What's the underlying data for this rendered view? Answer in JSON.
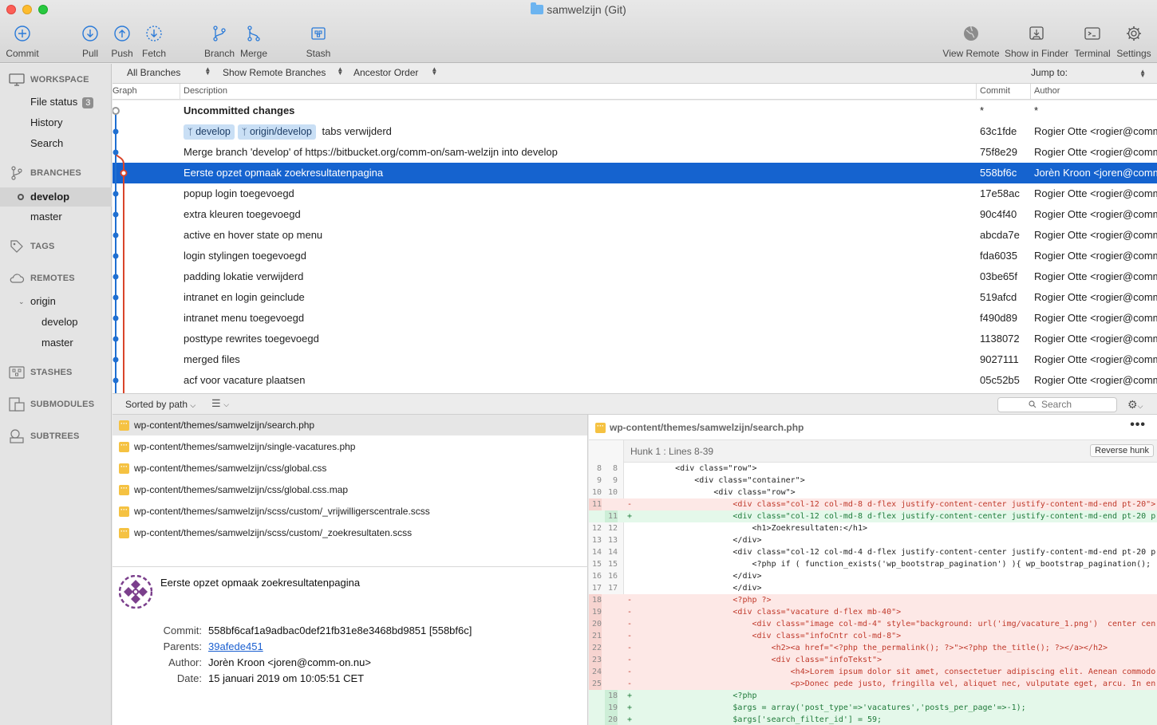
{
  "window": {
    "title": "samwelzijn (Git)"
  },
  "toolbar": {
    "commit": "Commit",
    "pull": "Pull",
    "push": "Push",
    "fetch": "Fetch",
    "branch": "Branch",
    "merge": "Merge",
    "stash": "Stash",
    "view_remote": "View Remote",
    "show_in_finder": "Show in Finder",
    "terminal": "Terminal",
    "settings": "Settings"
  },
  "sidebar": {
    "workspace": "WORKSPACE",
    "file_status": "File status",
    "file_status_count": "3",
    "history": "History",
    "search": "Search",
    "branches": "BRANCHES",
    "branch_items": [
      "develop",
      "master"
    ],
    "tags": "TAGS",
    "remotes": "REMOTES",
    "remote_name": "origin",
    "remote_items": [
      "develop",
      "master"
    ],
    "stashes": "STASHES",
    "submodules": "SUBMODULES",
    "subtrees": "SUBTREES"
  },
  "filters": {
    "branches": "All Branches",
    "remote": "Show Remote Branches",
    "order": "Ancestor Order",
    "jump_to": "Jump to:"
  },
  "log": {
    "columns": {
      "graph": "Graph",
      "description": "Description",
      "commit": "Commit",
      "author": "Author"
    },
    "uncommitted": "Uncommitted changes",
    "uncommitted_commit": "*",
    "uncommitted_author": "*",
    "refs": [
      "develop",
      "origin/develop"
    ],
    "rows": [
      {
        "desc": "tabs verwijderd",
        "hash": "63c1fde",
        "author": "Rogier Otte <rogier@comm"
      },
      {
        "desc": "Merge branch 'develop' of https://bitbucket.org/comm-on/sam-welzijn into develop",
        "hash": "75f8e29",
        "author": "Rogier Otte <rogier@comm"
      },
      {
        "desc": "Eerste opzet opmaak zoekresultatenpagina",
        "hash": "558bf6c",
        "author": "Jorèn Kroon <joren@comm"
      },
      {
        "desc": "popup login toegevoegd",
        "hash": "17e58ac",
        "author": "Rogier Otte <rogier@comm"
      },
      {
        "desc": "extra kleuren toegevoegd",
        "hash": "90c4f40",
        "author": "Rogier Otte <rogier@comm"
      },
      {
        "desc": "active en hover state op menu",
        "hash": "abcda7e",
        "author": "Rogier Otte <rogier@comm"
      },
      {
        "desc": "login stylingen toegevoegd",
        "hash": "fda6035",
        "author": "Rogier Otte <rogier@comm"
      },
      {
        "desc": "padding lokatie verwijderd",
        "hash": "03be65f",
        "author": "Rogier Otte <rogier@comm"
      },
      {
        "desc": "intranet en login geinclude",
        "hash": "519afcd",
        "author": "Rogier Otte <rogier@comm"
      },
      {
        "desc": "intranet menu toegevoegd",
        "hash": "f490d89",
        "author": "Rogier Otte <rogier@comm"
      },
      {
        "desc": "posttype rewrites toegevoegd",
        "hash": "1138072",
        "author": "Rogier Otte <rogier@comm"
      },
      {
        "desc": "merged files",
        "hash": "9027111",
        "author": "Rogier Otte <rogier@comm"
      },
      {
        "desc": "acf voor vacature plaatsen",
        "hash": "05c52b5",
        "author": "Rogier Otte <rogier@comm"
      }
    ]
  },
  "lowbar": {
    "sorted": "Sorted by path",
    "search_placeholder": "Search"
  },
  "files": [
    "wp-content/themes/samwelzijn/search.php",
    "wp-content/themes/samwelzijn/single-vacatures.php",
    "wp-content/themes/samwelzijn/css/global.css",
    "wp-content/themes/samwelzijn/css/global.css.map",
    "wp-content/themes/samwelzijn/scss/custom/_vrijwilligerscentrale.scss",
    "wp-content/themes/samwelzijn/scss/custom/_zoekresultaten.scss"
  ],
  "details": {
    "title": "Eerste opzet opmaak zoekresultatenpagina",
    "commit_label": "Commit:",
    "commit": "558bf6caf1a9adbac0def21fb31e8e3468bd9851 [558bf6c]",
    "parents_label": "Parents:",
    "parents": "39afede451",
    "author_label": "Author:",
    "author": "Jorèn Kroon <joren@comm-on.nu>",
    "date_label": "Date:",
    "date": "15 januari 2019 om 10:05:51 CET"
  },
  "diff": {
    "path": "wp-content/themes/samwelzijn/search.php",
    "hunk": "Hunk 1 : Lines 8-39",
    "reverse": "Reverse hunk",
    "more": "•••",
    "lines": [
      {
        "t": "ctx",
        "o": "8",
        "n": "8",
        "m": "",
        "c": "        <div class=\"row\">"
      },
      {
        "t": "ctx",
        "o": "9",
        "n": "9",
        "m": "",
        "c": "            <div class=\"container\">"
      },
      {
        "t": "ctx",
        "o": "10",
        "n": "10",
        "m": "",
        "c": "                <div class=\"row\">"
      },
      {
        "t": "del",
        "o": "11",
        "n": "",
        "m": "-",
        "c": "                    <div class=\"col-12 col-md-8 d-flex justify-content-center justify-content-md-end pt-20\">"
      },
      {
        "t": "add",
        "o": "",
        "n": "11",
        "m": "+",
        "c": "                    <div class=\"col-12 col-md-8 d-flex justify-content-center justify-content-md-end pt-20 p"
      },
      {
        "t": "ctx",
        "o": "12",
        "n": "12",
        "m": "",
        "c": "                        <h1>Zoekresultaten:</h1>"
      },
      {
        "t": "ctx",
        "o": "13",
        "n": "13",
        "m": "",
        "c": "                    </div>"
      },
      {
        "t": "ctx",
        "o": "14",
        "n": "14",
        "m": "",
        "c": "                    <div class=\"col-12 col-md-4 d-flex justify-content-center justify-content-md-end pt-20 p"
      },
      {
        "t": "ctx",
        "o": "15",
        "n": "15",
        "m": "",
        "c": "                        <?php if ( function_exists('wp_bootstrap_pagination') ){ wp_bootstrap_pagination();"
      },
      {
        "t": "ctx",
        "o": "16",
        "n": "16",
        "m": "",
        "c": "                    </div>"
      },
      {
        "t": "ctx",
        "o": "17",
        "n": "17",
        "m": "",
        "c": "                    </div>"
      },
      {
        "t": "del",
        "o": "18",
        "n": "",
        "m": "-",
        "c": "                    <?php ?>"
      },
      {
        "t": "del",
        "o": "19",
        "n": "",
        "m": "-",
        "c": "                    <div class=\"vacature d-flex mb-40\">"
      },
      {
        "t": "del",
        "o": "20",
        "n": "",
        "m": "-",
        "c": "                        <div class=\"image col-md-4\" style=\"background: url('img/vacature_1.png')  center cen"
      },
      {
        "t": "del",
        "o": "21",
        "n": "",
        "m": "-",
        "c": "                        <div class=\"infoCntr col-md-8\">"
      },
      {
        "t": "del",
        "o": "22",
        "n": "",
        "m": "-",
        "c": "                            <h2><a href=\"<?php the_permalink(); ?>\"><?php the_title(); ?></a></h2>"
      },
      {
        "t": "del",
        "o": "23",
        "n": "",
        "m": "-",
        "c": "                            <div class=\"infoTekst\">"
      },
      {
        "t": "del",
        "o": "24",
        "n": "",
        "m": "-",
        "c": "                                <h4>Lorem ipsum dolor sit amet, consectetuer adipiscing elit. Aenean commodo"
      },
      {
        "t": "del",
        "o": "25",
        "n": "",
        "m": "-",
        "c": "                                <p>Donec pede justo, fringilla vel, aliquet nec, vulputate eget, arcu. In en"
      },
      {
        "t": "add",
        "o": "",
        "n": "18",
        "m": "+",
        "c": "                    <?php"
      },
      {
        "t": "add",
        "o": "",
        "n": "19",
        "m": "+",
        "c": "                    $args = array('post_type'=>'vacatures','posts_per_page'=>-1);"
      },
      {
        "t": "add",
        "o": "",
        "n": "20",
        "m": "+",
        "c": "                    $args['search_filter_id'] = 59;"
      }
    ]
  },
  "colors": {
    "accent": "#1563cf",
    "graph_blue": "#1f6fd1",
    "graph_red": "#d9452b",
    "file_modified": "#f5c242"
  }
}
